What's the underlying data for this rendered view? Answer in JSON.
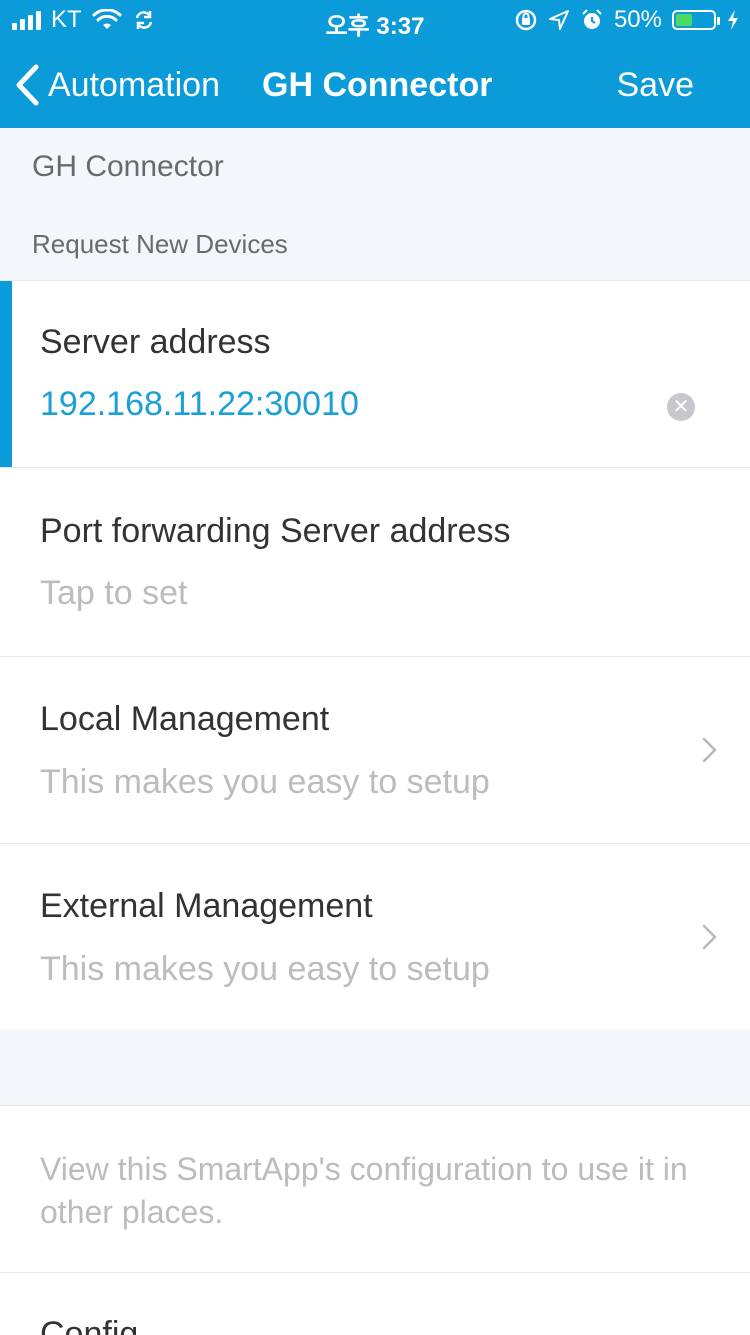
{
  "status": {
    "carrier": "KT",
    "time": "오후 3:37",
    "battery": "50%",
    "battery_level": 0.5
  },
  "nav": {
    "back_label": "Automation",
    "title": "GH Connector",
    "save_label": "Save"
  },
  "section": {
    "app_name": "GH Connector",
    "subheader": "Request New Devices"
  },
  "rows": [
    {
      "label": "Server address",
      "value": "192.168.11.22:30010"
    },
    {
      "label": "Port forwarding Server address",
      "value": "Tap to set"
    },
    {
      "label": "Local Management",
      "value": "This makes you easy to setup"
    },
    {
      "label": "External Management",
      "value": "This makes you easy to setup"
    }
  ],
  "info": {
    "text": "View this SmartApp's configuration to use it in other places."
  },
  "config": {
    "label": "Config"
  },
  "colors": {
    "header": "#0a9bd8",
    "accent": "#1a9fd6",
    "background": "#f3f6fb"
  }
}
